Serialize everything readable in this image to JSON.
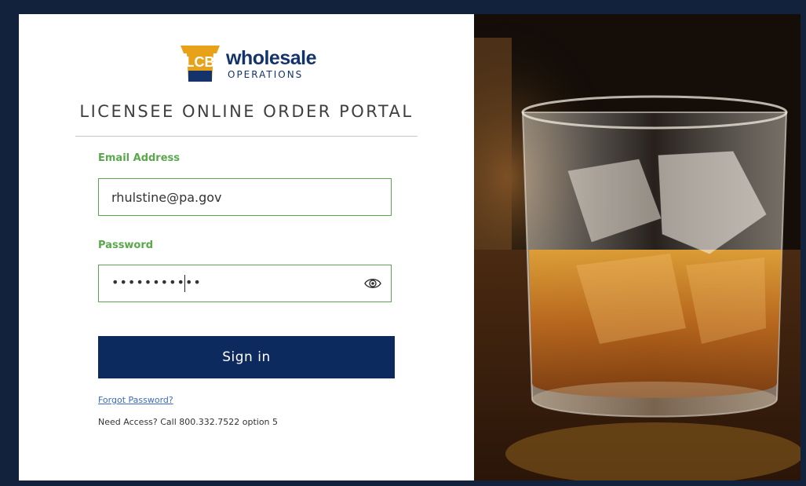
{
  "brand": {
    "logo_mark_text": "LCB",
    "logo_word": "wholesale",
    "logo_sub": "OPERATIONS",
    "portal_title": "LICENSEE ONLINE ORDER PORTAL"
  },
  "form": {
    "email_label": "Email Address",
    "email_value": "rhulstine@pa.gov",
    "password_label": "Password",
    "password_mask": "•••••••••••",
    "signin_label": "Sign in",
    "forgot_label": "Forgot Password?",
    "access_text": "Need Access? Call 800.332.7522 option 5"
  },
  "icons": {
    "show_password": "eye-icon"
  },
  "colors": {
    "accent_green": "#5aa84c",
    "navy": "#0d2a5e",
    "brand_gold": "#e8a21a",
    "link_blue": "#3a6cc0"
  }
}
